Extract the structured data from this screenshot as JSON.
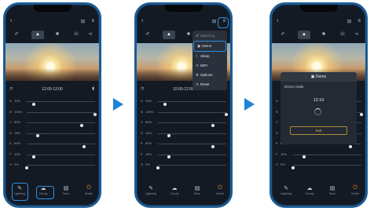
{
  "colors": {
    "phone_frame": "#1d5b92",
    "highlight": "#2f8fe0",
    "arrow": "#1f84d8",
    "power": "#e98a2c"
  },
  "phone1": {
    "time": "12:00-12:00",
    "channels": [
      {
        "label": "A",
        "pct": "10%",
        "value": 0.1
      },
      {
        "label": "B",
        "pct": "100%",
        "value": 1.0
      },
      {
        "label": "C",
        "pct": "80%",
        "value": 0.8
      },
      {
        "label": "D",
        "pct": "16%",
        "value": 0.16
      },
      {
        "label": "E",
        "pct": "84%",
        "value": 0.84
      },
      {
        "label": "F",
        "pct": "10%",
        "value": 0.1
      },
      {
        "label": "G",
        "pct": "0%",
        "value": 0.0
      }
    ],
    "tabs": [
      {
        "icon": "lightning-icon",
        "glyph": "✎",
        "label": "Lightning"
      },
      {
        "icon": "cloud-icon",
        "glyph": "☁",
        "label": "Cloudy"
      },
      {
        "icon": "save-icon",
        "glyph": "▤",
        "label": "Save"
      },
      {
        "icon": "power-icon",
        "glyph": "⏻",
        "label": "Switch"
      }
    ]
  },
  "phone2": {
    "time": "10:00-12:00",
    "menu": [
      {
        "glyph": "↺",
        "label": "Matching",
        "dim": true
      },
      {
        "glyph": "▣",
        "label": "Demo",
        "selected": true
      },
      {
        "glyph": "☾",
        "label": "Sleep"
      },
      {
        "glyph": "≋",
        "label": "WIFI"
      },
      {
        "glyph": "⚙",
        "label": "Options"
      },
      {
        "glyph": "⟲",
        "label": "Reset"
      }
    ],
    "channels": [
      {
        "label": "A",
        "pct": "10%",
        "value": 0.1
      },
      {
        "label": "B",
        "pct": "100%",
        "value": 1.0
      },
      {
        "label": "C",
        "pct": "80%",
        "value": 0.8
      },
      {
        "label": "D",
        "pct": "16%",
        "value": 0.16
      },
      {
        "label": "E",
        "pct": "80%",
        "value": 0.8
      },
      {
        "label": "F",
        "pct": "16%",
        "value": 0.16
      },
      {
        "label": "G",
        "pct": "0%",
        "value": 0.0
      }
    ],
    "tabs": [
      {
        "icon": "lightning-icon",
        "glyph": "✎",
        "label": "Lightning"
      },
      {
        "icon": "cloud-icon",
        "glyph": "☁",
        "label": "Cloudy"
      },
      {
        "icon": "save-icon",
        "glyph": "▤",
        "label": "Save"
      },
      {
        "icon": "power-icon",
        "glyph": "⏻",
        "label": "Switch"
      }
    ]
  },
  "phone3": {
    "dialog": {
      "title": "Demo",
      "mode_label": "Demo mode",
      "time": "12:10",
      "exit": "Exit"
    },
    "channels": [
      {
        "label": "A",
        "pct": "",
        "value": 0.1
      },
      {
        "label": "B",
        "pct": "",
        "value": 1.0
      },
      {
        "label": "C",
        "pct": "",
        "value": 0.8
      },
      {
        "label": "D",
        "pct": "",
        "value": 0.16
      },
      {
        "label": "E",
        "pct": "84%",
        "value": 0.84
      },
      {
        "label": "F",
        "pct": "16%",
        "value": 0.16
      },
      {
        "label": "G",
        "pct": "0%",
        "value": 0.0
      }
    ],
    "tabs": [
      {
        "icon": "lightning-icon",
        "glyph": "✎",
        "label": "Lightning"
      },
      {
        "icon": "cloud-icon",
        "glyph": "☁",
        "label": "Cloudy"
      },
      {
        "icon": "save-icon",
        "glyph": "▤",
        "label": "Save"
      },
      {
        "icon": "power-icon",
        "glyph": "⏻",
        "label": "Switch"
      }
    ]
  }
}
